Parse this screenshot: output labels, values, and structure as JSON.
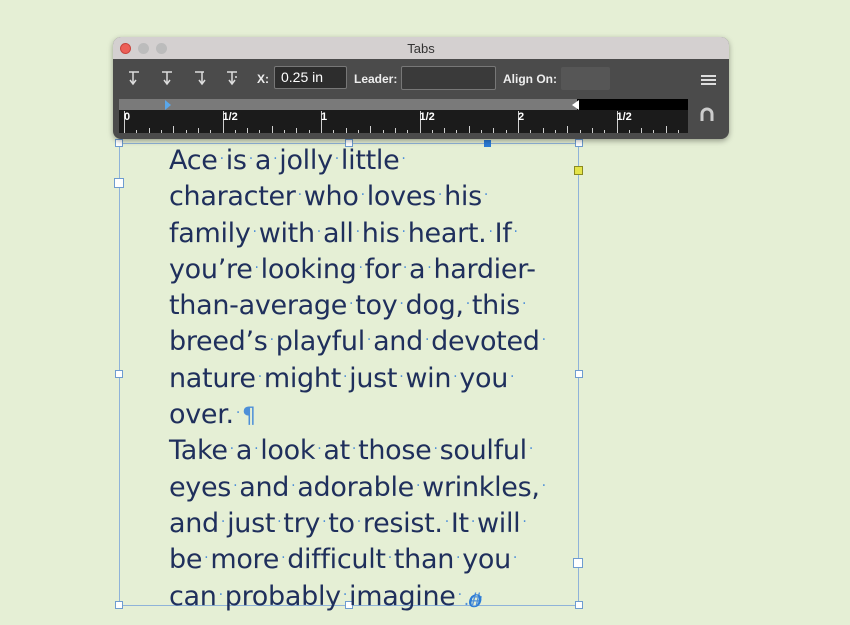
{
  "panel": {
    "title": "Tabs",
    "x_label": "X:",
    "x_value": "0.25 in",
    "leader_label": "Leader:",
    "leader_value": "",
    "align_label": "Align On:",
    "align_value": "",
    "tab_buttons": [
      "left-justified-tab-icon",
      "center-justified-tab-icon",
      "right-justified-tab-icon",
      "align-to-decimal-tab-icon"
    ],
    "ruler_labels": [
      "0",
      "1/2",
      "1",
      "1/2",
      "2",
      "1/2"
    ],
    "accent_color": "#5aa7ea"
  },
  "story": {
    "lines": [
      [
        "Ace",
        "is",
        "a",
        "jolly",
        "little",
        ""
      ],
      [
        "character",
        "who",
        "loves",
        "his",
        ""
      ],
      [
        "family",
        "with",
        "all",
        "his",
        "heart.",
        "If",
        ""
      ],
      [
        "you’re",
        "looking",
        "for",
        "a",
        "hardier-"
      ],
      [
        "than-average",
        "toy",
        "dog,",
        "this",
        ""
      ],
      [
        "breed’s",
        "playful",
        "and",
        "devoted",
        ""
      ],
      [
        "nature",
        "might",
        "just",
        "win",
        "you",
        ""
      ],
      [
        "over.",
        "¶"
      ],
      [
        "Take",
        "a",
        "look",
        "at",
        "those",
        "soulful",
        ""
      ],
      [
        "eyes",
        "and",
        "adorable",
        "wrinkles,",
        ""
      ],
      [
        "and",
        "just",
        "try",
        "to",
        "resist.",
        "It",
        "will",
        ""
      ],
      [
        "be",
        "more",
        "difficult",
        "than",
        "you",
        ""
      ],
      [
        "can",
        "probably",
        "imagine",
        ".#"
      ]
    ],
    "text_color": "#1f2f5c",
    "invisible_char_color": "#4d8fd8"
  }
}
